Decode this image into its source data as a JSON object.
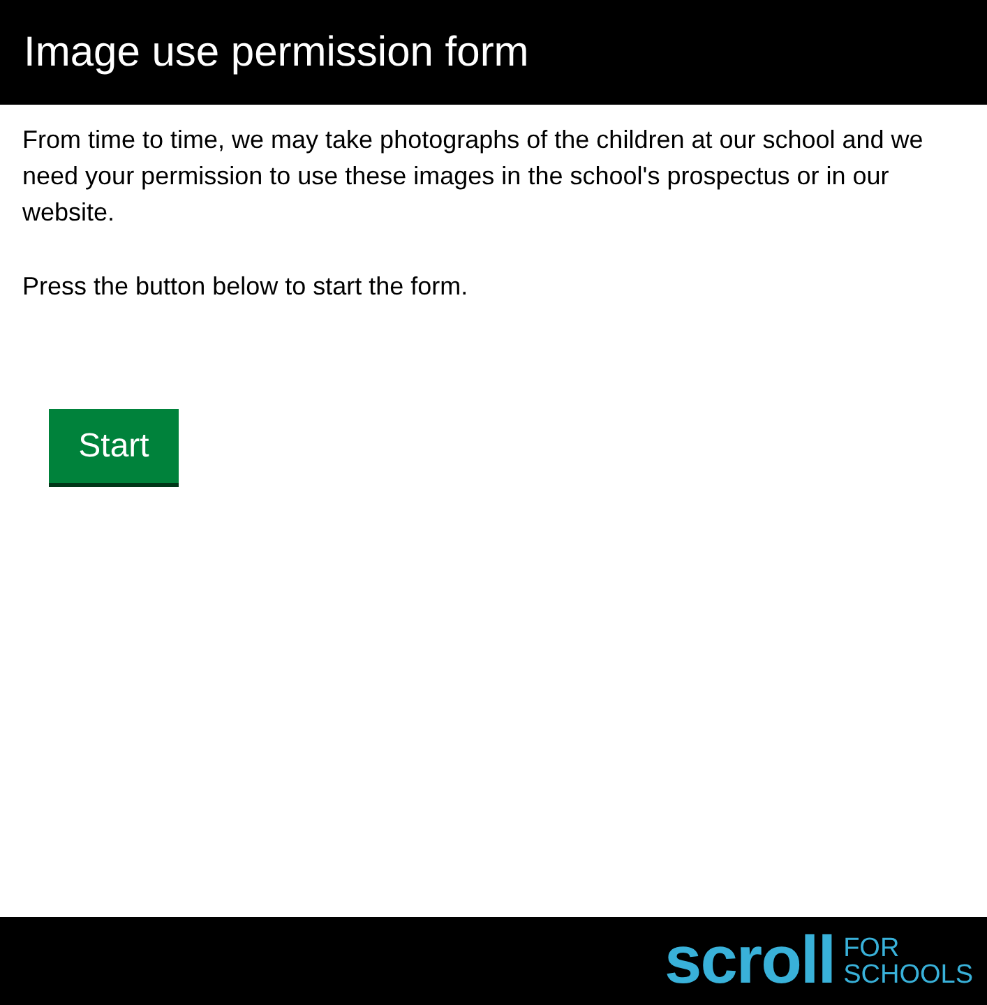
{
  "header": {
    "title": "Image use permission form"
  },
  "intro": [
    "From time to time, we may take photographs of the children at our school and we need your permission to use these images in the school's prospectus or in our website.",
    "Press the button below to start the form."
  ],
  "start_button": "Start",
  "footer": {
    "logo_word": "scroll",
    "logo_tagline": [
      "FOR",
      "SCHOOLS"
    ]
  }
}
